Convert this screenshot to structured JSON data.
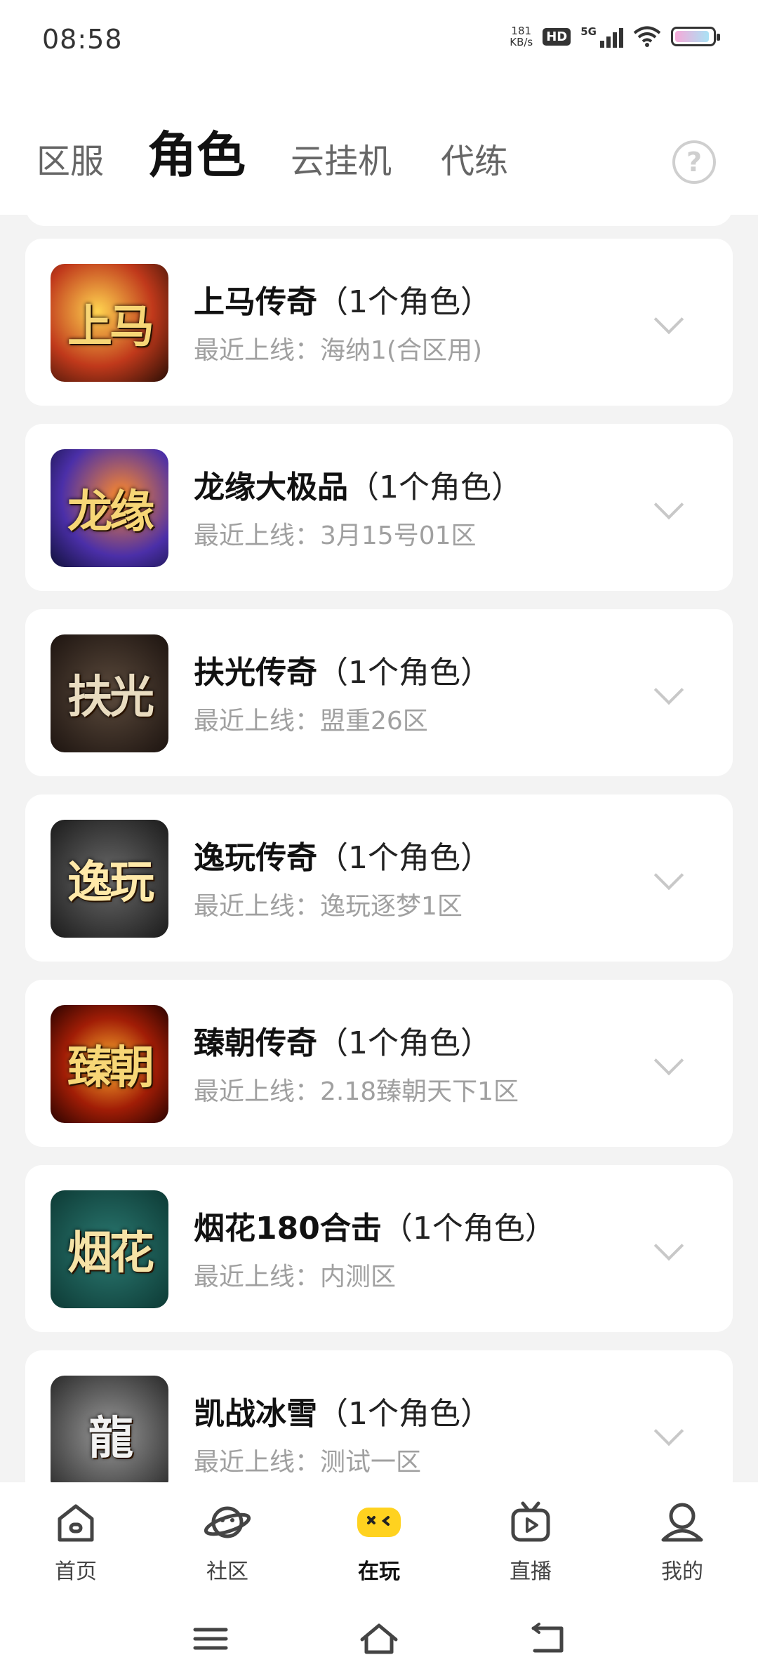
{
  "status_bar": {
    "time": "08:58",
    "net_speed": "181",
    "net_unit": "KB/s",
    "hd_label": "HD",
    "signal_label": "5G"
  },
  "tabs": [
    {
      "label": "区服",
      "active": false
    },
    {
      "label": "角色",
      "active": true
    },
    {
      "label": "云挂机",
      "active": false
    },
    {
      "label": "代练",
      "active": false
    }
  ],
  "help_icon": "question-circle-icon",
  "games": [
    {
      "name": "上马传奇",
      "count": "（1个角色）",
      "last_login": "最近上线：海纳1(合区用)",
      "thumb_text": "上马"
    },
    {
      "name": "龙缘大极品",
      "count": "（1个角色）",
      "last_login": "最近上线：3月15号01区",
      "thumb_text": "龙缘"
    },
    {
      "name": "扶光传奇",
      "count": "（1个角色）",
      "last_login": "最近上线：盟重26区",
      "thumb_text": "扶光"
    },
    {
      "name": "逸玩传奇",
      "count": "（1个角色）",
      "last_login": "最近上线：逸玩逐梦1区",
      "thumb_text": "逸玩"
    },
    {
      "name": "臻朝传奇",
      "count": "（1个角色）",
      "last_login": "最近上线：2.18臻朝天下1区",
      "thumb_text": "臻朝"
    },
    {
      "name": "烟花180合击",
      "count": "（1个角色）",
      "last_login": "最近上线：内测区",
      "thumb_text": "烟花"
    },
    {
      "name": "凯战冰雪",
      "count": "（1个角色）",
      "last_login": "最近上线：测试一区",
      "thumb_text": "龍"
    }
  ],
  "bottom_nav": [
    {
      "label": "首页",
      "icon": "home-icon",
      "active": false
    },
    {
      "label": "社区",
      "icon": "planet-icon",
      "active": false
    },
    {
      "label": "在玩",
      "icon": "gamepad-icon",
      "active": true
    },
    {
      "label": "直播",
      "icon": "tv-play-icon",
      "active": false
    },
    {
      "label": "我的",
      "icon": "user-icon",
      "active": false
    }
  ],
  "colors": {
    "accent_yellow": "#ffd21f",
    "background": "#f3f3f3",
    "subtext": "#a0a0a0"
  }
}
